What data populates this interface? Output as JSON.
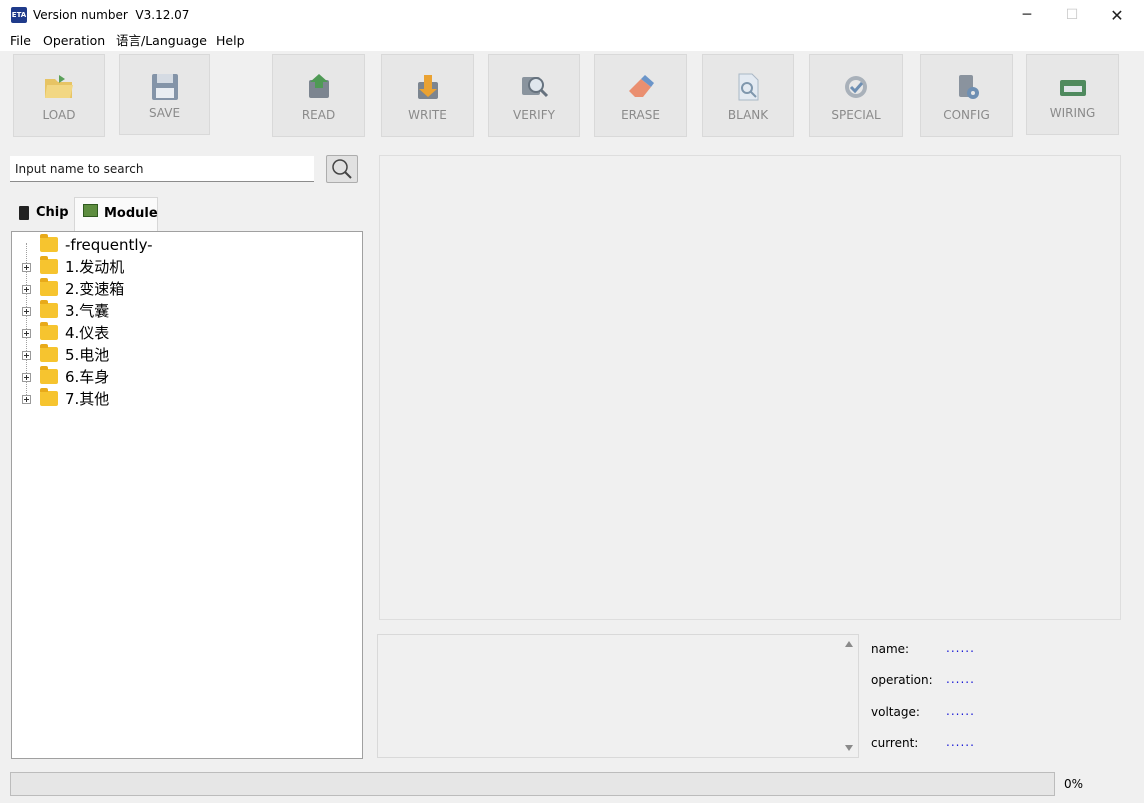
{
  "window": {
    "title": "Version number  V3.12.07",
    "icon_text": "ETA",
    "minimize": "─",
    "maximize": "☐",
    "close": "✕"
  },
  "menu": [
    "File",
    "Operation",
    "语言/Language",
    "Help"
  ],
  "toolbar": [
    {
      "label": "LOAD",
      "icon": "folder-open-icon",
      "color": "#e9b84a"
    },
    {
      "label": "SAVE",
      "icon": "floppy-disk-icon",
      "color": "#7b8fa6"
    },
    {
      "label": "READ",
      "icon": "chip-read-icon",
      "color": "#4f8f4f"
    },
    {
      "label": "WRITE",
      "icon": "chip-write-icon",
      "color": "#e9a430"
    },
    {
      "label": "VERIFY",
      "icon": "magnifier-chip-icon",
      "color": "#7d8c99"
    },
    {
      "label": "ERASE",
      "icon": "eraser-icon",
      "color": "#e58a6a"
    },
    {
      "label": "BLANK",
      "icon": "blank-page-icon",
      "color": "#b7c6d6"
    },
    {
      "label": "SPECIAL",
      "icon": "gear-check-icon",
      "color": "#9aa3ad"
    },
    {
      "label": "CONFIG",
      "icon": "config-chip-icon",
      "color": "#7d8793"
    },
    {
      "label": "WIRING",
      "icon": "wiring-board-icon",
      "color": "#3f7a52"
    }
  ],
  "search": {
    "placeholder": "Input name to search"
  },
  "tabs": [
    {
      "label": "Chip",
      "icon": "chip-icon"
    },
    {
      "label": "Module",
      "icon": "module-icon"
    }
  ],
  "tree": [
    {
      "label": "-frequently-",
      "expandable": false
    },
    {
      "label": "1.发动机",
      "expandable": true
    },
    {
      "label": "2.变速箱",
      "expandable": true
    },
    {
      "label": "3.气囊",
      "expandable": true
    },
    {
      "label": "4.仪表",
      "expandable": true
    },
    {
      "label": "5.电池",
      "expandable": true
    },
    {
      "label": "6.车身",
      "expandable": true
    },
    {
      "label": "7.其他",
      "expandable": true
    }
  ],
  "info": [
    {
      "label": "name:",
      "value": "......"
    },
    {
      "label": "operation:",
      "value": "......"
    },
    {
      "label": "voltage:",
      "value": "......"
    },
    {
      "label": "current:",
      "value": "......"
    }
  ],
  "progress": {
    "value": 0,
    "text": "0%"
  }
}
